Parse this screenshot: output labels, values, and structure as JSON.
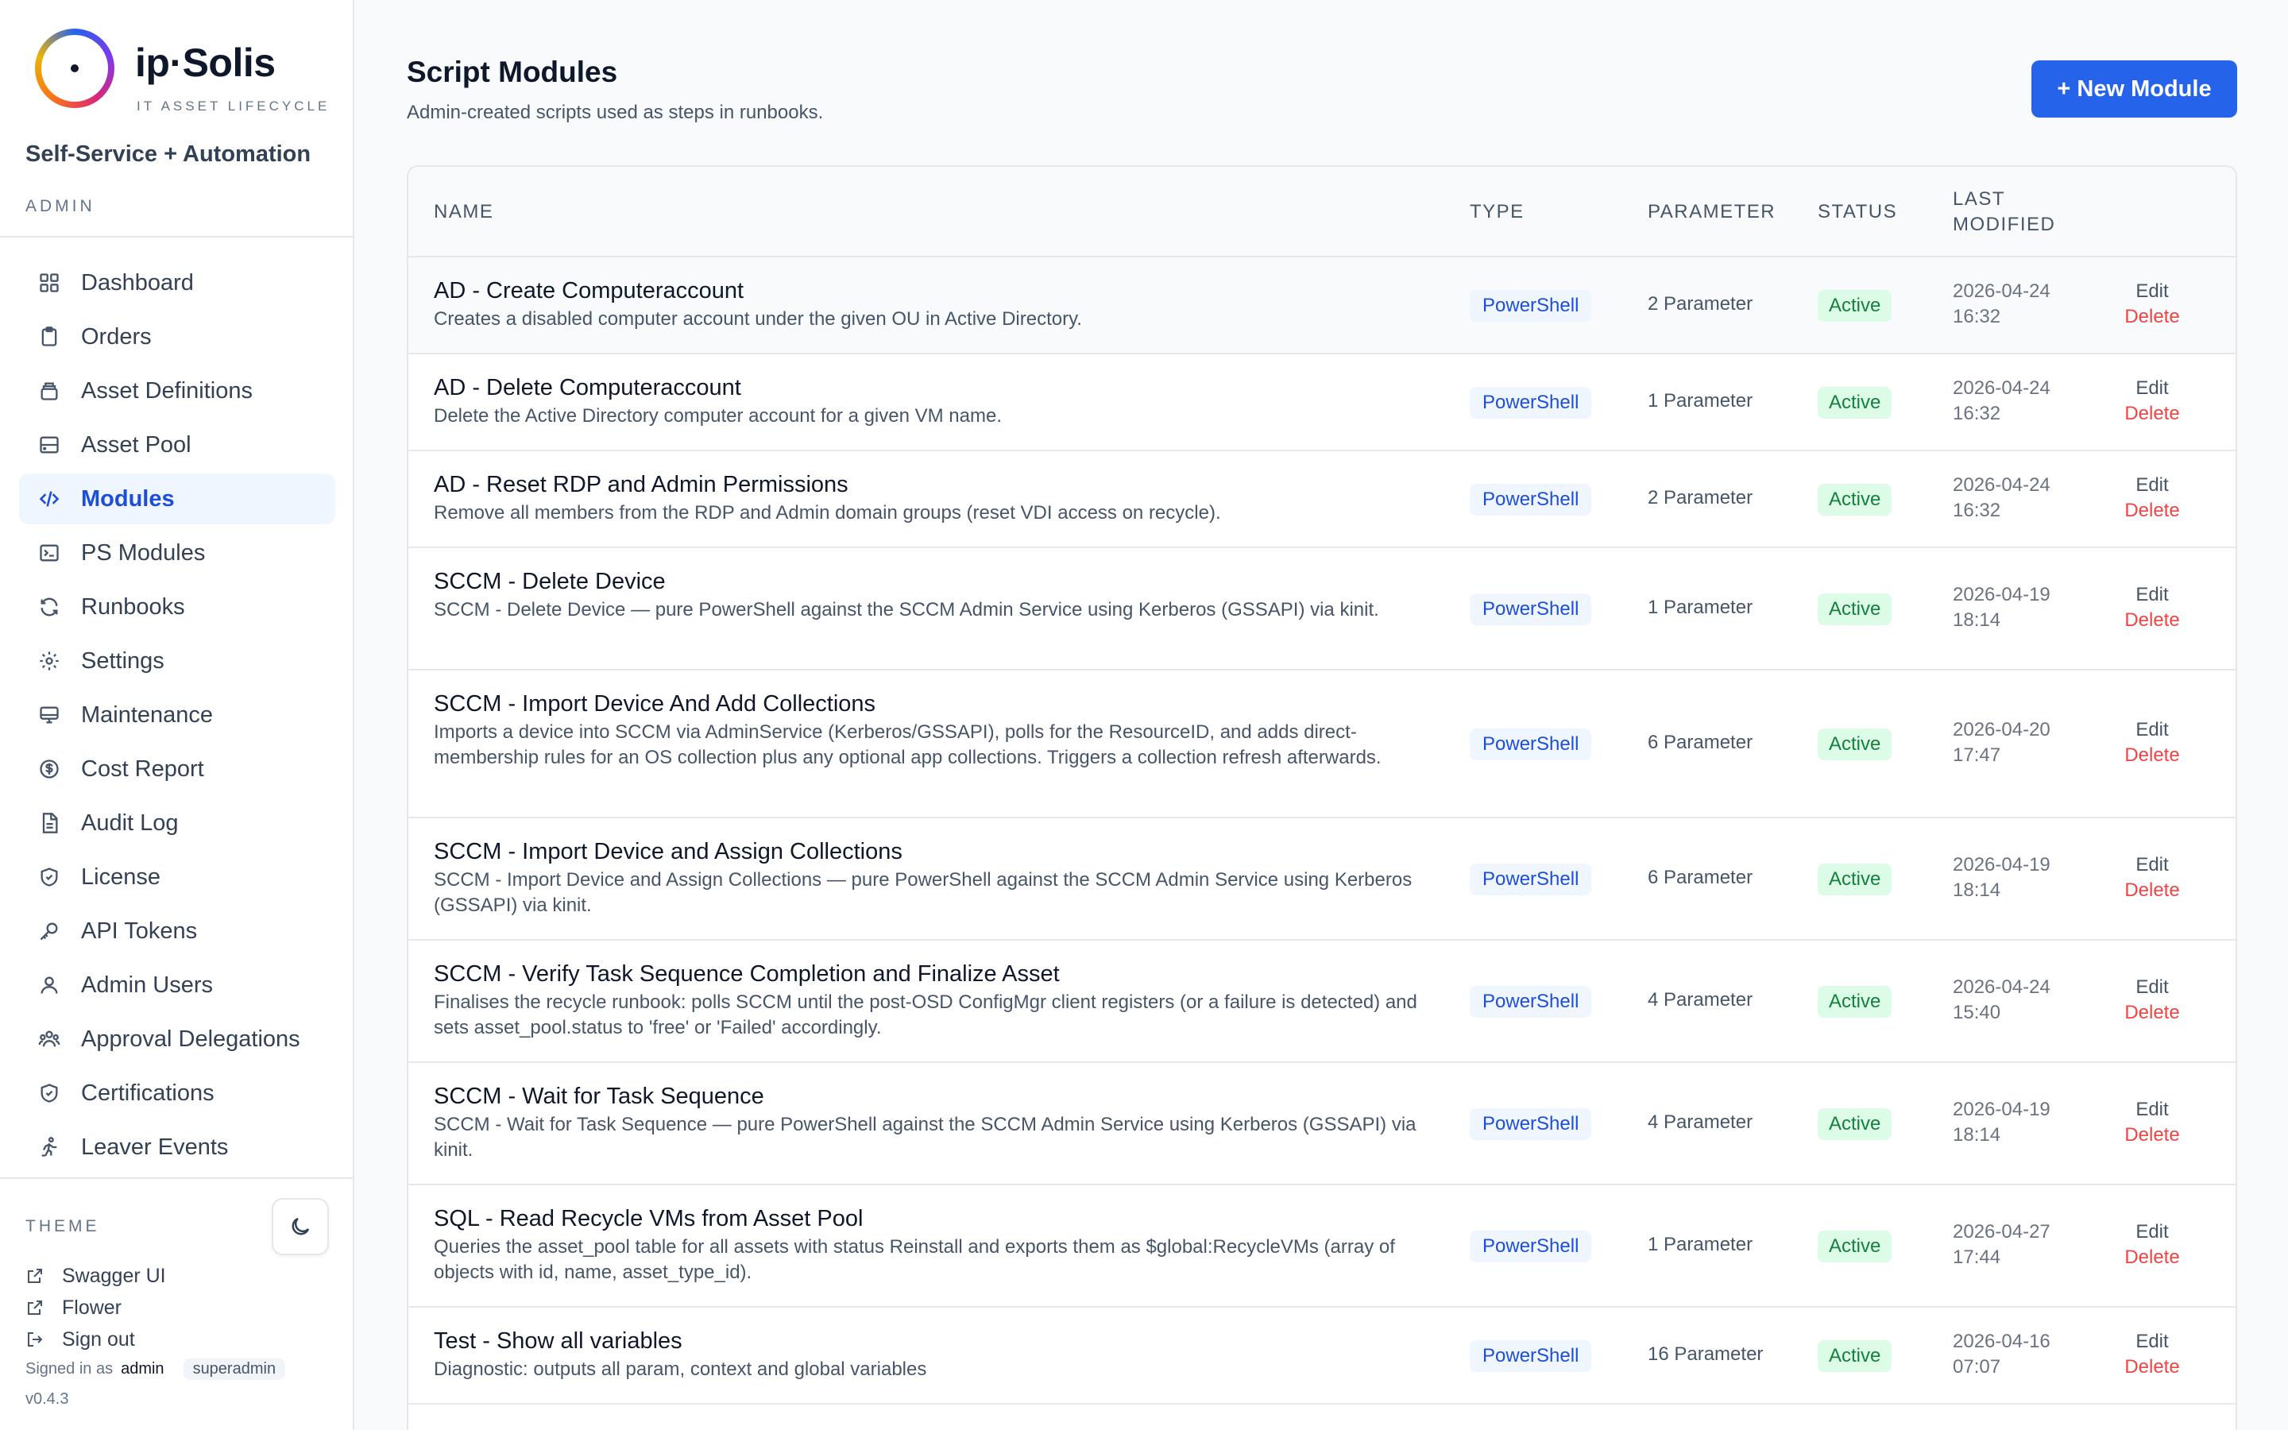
{
  "brand": {
    "name": "ip·Solis",
    "tagline": "IT ASSET LIFECYCLE"
  },
  "app_subtitle": "Self-Service + Automation",
  "section_label": "ADMIN",
  "nav": [
    {
      "label": "Dashboard",
      "icon": "grid-icon"
    },
    {
      "label": "Orders",
      "icon": "clipboard-icon"
    },
    {
      "label": "Asset Definitions",
      "icon": "layers-icon"
    },
    {
      "label": "Asset Pool",
      "icon": "server-icon"
    },
    {
      "label": "Modules",
      "icon": "code-icon",
      "active": true
    },
    {
      "label": "PS Modules",
      "icon": "terminal-icon"
    },
    {
      "label": "Runbooks",
      "icon": "refresh-icon"
    },
    {
      "label": "Settings",
      "icon": "gear-icon"
    },
    {
      "label": "Maintenance",
      "icon": "monitor-icon"
    },
    {
      "label": "Cost Report",
      "icon": "dollar-icon"
    },
    {
      "label": "Audit Log",
      "icon": "document-icon"
    },
    {
      "label": "License",
      "icon": "shield-icon"
    },
    {
      "label": "API Tokens",
      "icon": "key-icon"
    },
    {
      "label": "Admin Users",
      "icon": "user-icon"
    },
    {
      "label": "Approval Delegations",
      "icon": "users-icon"
    },
    {
      "label": "Certifications",
      "icon": "shield-check-icon"
    },
    {
      "label": "Leaver Events",
      "icon": "exit-icon"
    }
  ],
  "theme_label": "THEME",
  "footer_links": [
    {
      "label": "Swagger UI",
      "icon": "external-link-icon"
    },
    {
      "label": "Flower",
      "icon": "external-link-icon"
    },
    {
      "label": "Sign out",
      "icon": "sign-out-icon"
    }
  ],
  "signed_in": {
    "prefix": "Signed in as",
    "user": "admin",
    "role": "superadmin"
  },
  "version": "v0.4.3",
  "page": {
    "title": "Script Modules",
    "subtitle": "Admin-created scripts used as steps in runbooks.",
    "new_button": "+ New Module"
  },
  "table": {
    "headers": {
      "name": "NAME",
      "type": "TYPE",
      "parameter": "PARAMETER",
      "status": "STATUS",
      "modified_1": "LAST",
      "modified_2": "MODIFIED"
    },
    "rows": [
      {
        "name": "AD - Create Computeraccount",
        "description": "Creates a disabled computer account under the given OU in Active Directory.",
        "type": "PowerShell",
        "params": "2 Parameter",
        "status": "Active",
        "date": "2026-04-24",
        "time": "16:32",
        "edit": "Edit",
        "delete": "Delete"
      },
      {
        "name": "AD - Delete Computeraccount",
        "description": "Delete the Active Directory computer account for a given VM name.",
        "type": "PowerShell",
        "params": "1 Parameter",
        "status": "Active",
        "date": "2026-04-24",
        "time": "16:32",
        "edit": "Edit",
        "delete": "Delete"
      },
      {
        "name": "AD - Reset RDP and Admin Permissions",
        "description": "Remove all members from the RDP and Admin domain groups (reset VDI access on recycle).",
        "type": "PowerShell",
        "params": "2 Parameter",
        "status": "Active",
        "date": "2026-04-24",
        "time": "16:32",
        "edit": "Edit",
        "delete": "Delete"
      },
      {
        "name": "SCCM - Delete Device",
        "description": "SCCM - Delete Device — pure PowerShell against the SCCM Admin Service using Kerberos (GSSAPI) via kinit.",
        "type": "PowerShell",
        "params": "1 Parameter",
        "status": "Active",
        "date": "2026-04-19",
        "time": "18:14",
        "edit": "Edit",
        "delete": "Delete"
      },
      {
        "name": "SCCM - Import Device And Add Collections",
        "description": "Imports a device into SCCM via AdminService (Kerberos/GSSAPI), polls for the ResourceID, and adds direct-membership rules for an OS collection plus any optional app collections. Triggers a collection refresh afterwards.",
        "type": "PowerShell",
        "params": "6 Parameter",
        "status": "Active",
        "date": "2026-04-20",
        "time": "17:47",
        "edit": "Edit",
        "delete": "Delete"
      },
      {
        "name": "SCCM - Import Device and Assign Collections",
        "description": "SCCM - Import Device and Assign Collections — pure PowerShell against the SCCM Admin Service using Kerberos (GSSAPI) via kinit.",
        "type": "PowerShell",
        "params": "6 Parameter",
        "status": "Active",
        "date": "2026-04-19",
        "time": "18:14",
        "edit": "Edit",
        "delete": "Delete"
      },
      {
        "name": "SCCM - Verify Task Sequence Completion and Finalize Asset",
        "description": "Finalises the recycle runbook: polls SCCM until the post-OSD ConfigMgr client registers (or a failure is detected) and sets asset_pool.status to 'free' or 'Failed' accordingly.",
        "type": "PowerShell",
        "params": "4 Parameter",
        "status": "Active",
        "date": "2026-04-24",
        "time": "15:40",
        "edit": "Edit",
        "delete": "Delete"
      },
      {
        "name": "SCCM - Wait for Task Sequence",
        "description": "SCCM - Wait for Task Sequence — pure PowerShell against the SCCM Admin Service using Kerberos (GSSAPI) via kinit.",
        "type": "PowerShell",
        "params": "4 Parameter",
        "status": "Active",
        "date": "2026-04-19",
        "time": "18:14",
        "edit": "Edit",
        "delete": "Delete"
      },
      {
        "name": "SQL - Read Recycle VMs from Asset Pool",
        "description": "Queries the asset_pool table for all assets with status Reinstall and exports them as $global:RecycleVMs (array of objects with id, name, asset_type_id).",
        "type": "PowerShell",
        "params": "1 Parameter",
        "status": "Active",
        "date": "2026-04-27",
        "time": "17:44",
        "edit": "Edit",
        "delete": "Delete"
      },
      {
        "name": "Test - Show all variables",
        "description": "Diagnostic: outputs all param, context and global variables",
        "type": "PowerShell",
        "params": "16 Parameter",
        "status": "Active",
        "date": "2026-04-16",
        "time": "07:07",
        "edit": "Edit",
        "delete": "Delete"
      }
    ]
  }
}
